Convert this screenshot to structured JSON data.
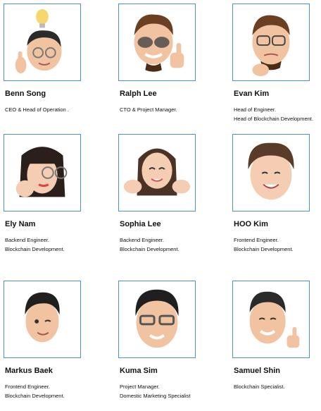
{
  "team": [
    {
      "name": "Benn Song",
      "roles": [
        "CEO & Head of Operation ."
      ],
      "avatar": "memoji-idea-avatar"
    },
    {
      "name": "Ralph Lee",
      "roles": [
        "CTO & Project Manager."
      ],
      "avatar": "memoji-sunglasses-thumbsup-avatar"
    },
    {
      "name": "Evan Kim",
      "roles": [
        "Head of Engineer.",
        "Head of Blockchain Development."
      ],
      "avatar": "memoji-thinking-avatar"
    },
    {
      "name": "Ely Nam",
      "roles": [
        "Backend Engineer.",
        "Blockchain Development."
      ],
      "avatar": "memoji-fist-avatar"
    },
    {
      "name": "Sophia Lee",
      "roles": [
        "Backend Engineer.",
        "Blockchain Development."
      ],
      "avatar": "memoji-jazzhands-avatar"
    },
    {
      "name": "HOO Kim",
      "roles": [
        "Frontend Engineer.",
        "Blockchain Development."
      ],
      "avatar": "memoji-smile-avatar"
    },
    {
      "name": "Markus Baek",
      "roles": [
        "Frontend Engineer.",
        "Blockchain Development."
      ],
      "avatar": "memoji-wink-avatar"
    },
    {
      "name": "Kuma Sim",
      "roles": [
        "Project Manager.",
        "Domestic Marketing Specialist"
      ],
      "avatar": "memoji-glasses-avatar"
    },
    {
      "name": "Samuel Shin",
      "roles": [
        "Blockchain Specialist."
      ],
      "avatar": "memoji-thumbsup-avatar"
    }
  ]
}
